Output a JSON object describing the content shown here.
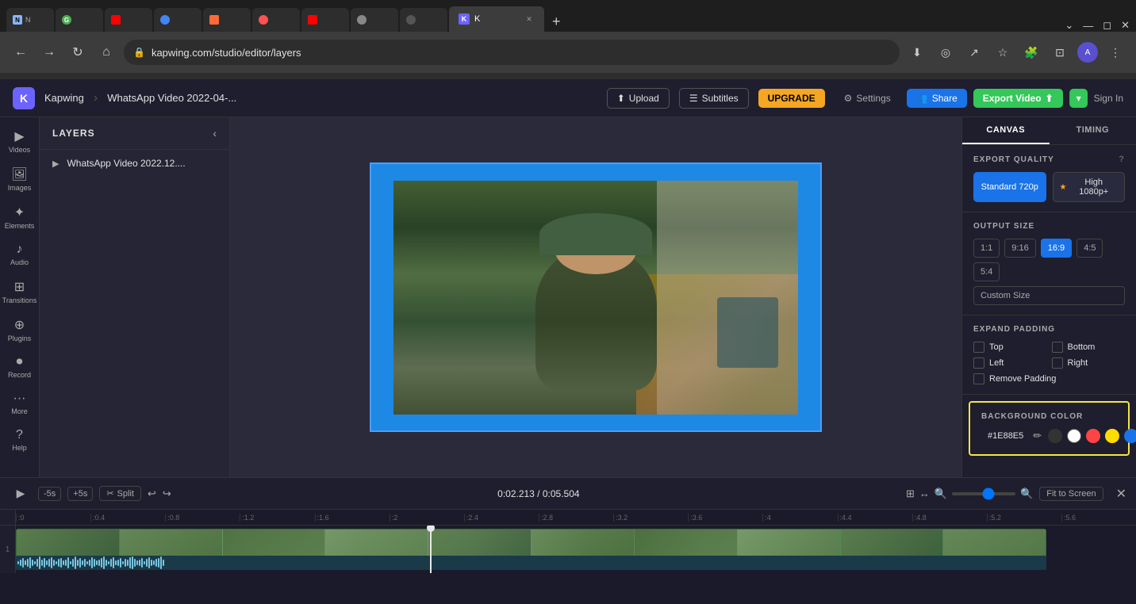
{
  "browser": {
    "tabs": [
      {
        "label": "N",
        "favicon_color": "#8ab4f8",
        "active": false
      },
      {
        "label": "G",
        "favicon_color": "#4CAF50",
        "active": false
      },
      {
        "label": "Y",
        "favicon_color": "#FF0000",
        "active": false
      },
      {
        "label": "G",
        "favicon_color": "#4285F4",
        "active": false
      },
      {
        "label": ">",
        "favicon_color": "#FF6B35",
        "active": false
      },
      {
        "label": "1",
        "favicon_color": "#FF5252",
        "active": false
      },
      {
        "label": "Y",
        "favicon_color": "#FF0000",
        "active": false
      },
      {
        "label": "K",
        "favicon_color": "#6c63ff",
        "active": true
      }
    ],
    "active_tab_label": "K",
    "address": "kapwing.com/studio/editor/layers"
  },
  "app_header": {
    "logo_label": "K",
    "brand": "Kapwing",
    "separator": "›",
    "project": "WhatsApp Video 2022-04-...",
    "upload_label": "Upload",
    "subtitles_label": "Subtitles",
    "upgrade_label": "UPGRADE",
    "settings_label": "Settings",
    "share_label": "Share",
    "export_label": "Export Video",
    "signin_label": "Sign In"
  },
  "layers_panel": {
    "title": "LAYERS",
    "layer_name": "WhatsApp Video 2022.12...."
  },
  "right_panel": {
    "tab_canvas": "CANVAS",
    "tab_timing": "TIMING",
    "export_quality_title": "EXPORT QUALITY",
    "standard_label": "Standard 720p",
    "high_label": "High 1080p+",
    "output_size_title": "OUTPUT SIZE",
    "sizes": [
      "1:1",
      "9:16",
      "16:9",
      "4:5",
      "5:4"
    ],
    "active_size": "16:9",
    "custom_size_label": "Custom Size",
    "expand_padding_title": "EXPAND PADDING",
    "padding_top": "Top",
    "padding_bottom": "Bottom",
    "padding_left": "Left",
    "padding_right": "Right",
    "remove_padding_label": "Remove Padding",
    "bg_color_title": "BACKGROUND COLOR",
    "bg_color_hex": "#1E88E5",
    "color_presets": [
      "#333333",
      "#ffffff",
      "#ff4444",
      "#ffdd00",
      "#1a73e8"
    ]
  },
  "timeline": {
    "time_skip_back": "-5s",
    "time_skip_fwd": "+5s",
    "split_label": "Split",
    "time_display": "0:02.213 / 0:05.504",
    "fit_screen_label": "Fit to Screen",
    "record_label": "Record"
  },
  "ruler_marks": [
    ":0",
    ":0.4",
    ":0.8",
    ":1.2",
    ":1.6",
    ":2",
    ":2.4",
    ":2.8",
    ":3.2",
    ":3.6",
    ":4",
    ":4.4",
    ":4.8",
    ":5.2",
    ":5.6"
  ]
}
